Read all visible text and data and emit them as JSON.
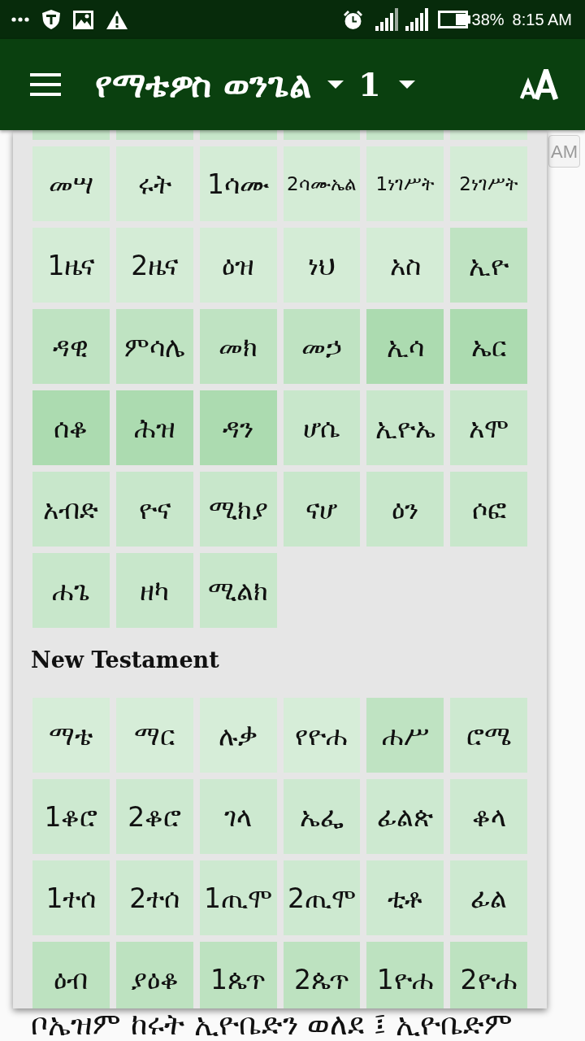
{
  "status_bar": {
    "battery_percent": "38%",
    "time": "8:15 AM"
  },
  "app_bar": {
    "title": "የማቴዎስ ወንጌል",
    "chapter": "1"
  },
  "page": {
    "period_button": "AM",
    "verse_text": "ቦኤዝም ከሩት ኢዮቤድን ወለደ ፤ ኢዮቤድም"
  },
  "book_picker": {
    "sections": [
      {
        "clipped_tiles": [
          {
            "color": "#c6e6c9"
          },
          {
            "color": "#c6e6c9"
          },
          {
            "color": "#c6e6c9"
          },
          {
            "color": "#c6e6c9"
          },
          {
            "color": "#c6e6c9"
          },
          {
            "color": "#d4ecd6"
          }
        ],
        "books": [
          {
            "label": "መሣ",
            "color": "#d4ecd6"
          },
          {
            "label": "ሩት",
            "color": "#d4ecd6"
          },
          {
            "label": "1ሳሙ",
            "color": "#d4ecd6"
          },
          {
            "label": "2ሳሙኤል",
            "color": "#d4ecd6"
          },
          {
            "label": "1ነገሥት",
            "color": "#d4ecd6"
          },
          {
            "label": "2ነገሥት",
            "color": "#d4ecd6"
          },
          {
            "label": "1ዜና",
            "color": "#d4ecd6"
          },
          {
            "label": "2ዜና",
            "color": "#d4ecd6"
          },
          {
            "label": "ዕዝ",
            "color": "#d4ecd6"
          },
          {
            "label": "ነህ",
            "color": "#d4ecd6"
          },
          {
            "label": "አስ",
            "color": "#d4ecd6"
          },
          {
            "label": "ኢዮ",
            "color": "#bfe3c2"
          },
          {
            "label": "ዳዊ",
            "color": "#bfe3c2"
          },
          {
            "label": "ምሳሌ",
            "color": "#bfe3c2"
          },
          {
            "label": "መክ",
            "color": "#bfe3c2"
          },
          {
            "label": "መኃ",
            "color": "#bfe3c2"
          },
          {
            "label": "ኢሳ",
            "color": "#acdbb0"
          },
          {
            "label": "ኤር",
            "color": "#acdbb0"
          },
          {
            "label": "ሰቆ",
            "color": "#acdbb0"
          },
          {
            "label": "ሕዝ",
            "color": "#acdbb0"
          },
          {
            "label": "ዳን",
            "color": "#acdbb0"
          },
          {
            "label": "ሆሴ",
            "color": "#c8e7cb"
          },
          {
            "label": "ኢዮኤ",
            "color": "#c8e7cb"
          },
          {
            "label": "አሞ",
            "color": "#c8e7cb"
          },
          {
            "label": "አብድ",
            "color": "#c8e7cb"
          },
          {
            "label": "ዮና",
            "color": "#c8e7cb"
          },
          {
            "label": "ሚክያ",
            "color": "#c8e7cb"
          },
          {
            "label": "ናሆ",
            "color": "#c8e7cb"
          },
          {
            "label": "ዕን",
            "color": "#c8e7cb"
          },
          {
            "label": "ሶፎ",
            "color": "#c8e7cb"
          },
          {
            "label": "ሐጌ",
            "color": "#c8e7cb"
          },
          {
            "label": "ዘካ",
            "color": "#c8e7cb"
          },
          {
            "label": "ሚልክ",
            "color": "#c8e7cb"
          }
        ]
      },
      {
        "title": "New Testament",
        "books": [
          {
            "label": "ማቴ",
            "color": "#d6edd8"
          },
          {
            "label": "ማር",
            "color": "#d6edd8"
          },
          {
            "label": "ሉቃ",
            "color": "#d6edd8"
          },
          {
            "label": "የዮሐ",
            "color": "#d6edd8"
          },
          {
            "label": "ሐሥ",
            "color": "#bfe3c2"
          },
          {
            "label": "ሮሜ",
            "color": "#cde9d0"
          },
          {
            "label": "1ቆሮ",
            "color": "#cde9d0"
          },
          {
            "label": "2ቆሮ",
            "color": "#cde9d0"
          },
          {
            "label": "ገላ",
            "color": "#cde9d0"
          },
          {
            "label": "ኤፌ",
            "color": "#cde9d0"
          },
          {
            "label": "ፊልጵ",
            "color": "#cde9d0"
          },
          {
            "label": "ቆላ",
            "color": "#cde9d0"
          },
          {
            "label": "1ተሰ",
            "color": "#cde9d0"
          },
          {
            "label": "2ተሰ",
            "color": "#cde9d0"
          },
          {
            "label": "1ጢሞ",
            "color": "#cde9d0"
          },
          {
            "label": "2ጢሞ",
            "color": "#cde9d0"
          },
          {
            "label": "ቲቶ",
            "color": "#cde9d0"
          },
          {
            "label": "ፊል",
            "color": "#cde9d0"
          },
          {
            "label": "ዕብ",
            "color": "#bde2c0"
          },
          {
            "label": "ያዕቆ",
            "color": "#bde2c0"
          },
          {
            "label": "1ጴጥ",
            "color": "#bde2c0"
          },
          {
            "label": "2ጴጥ",
            "color": "#bde2c0"
          },
          {
            "label": "1ዮሐ",
            "color": "#bde2c0"
          },
          {
            "label": "2ዮሐ",
            "color": "#bde2c0"
          }
        ]
      }
    ]
  }
}
